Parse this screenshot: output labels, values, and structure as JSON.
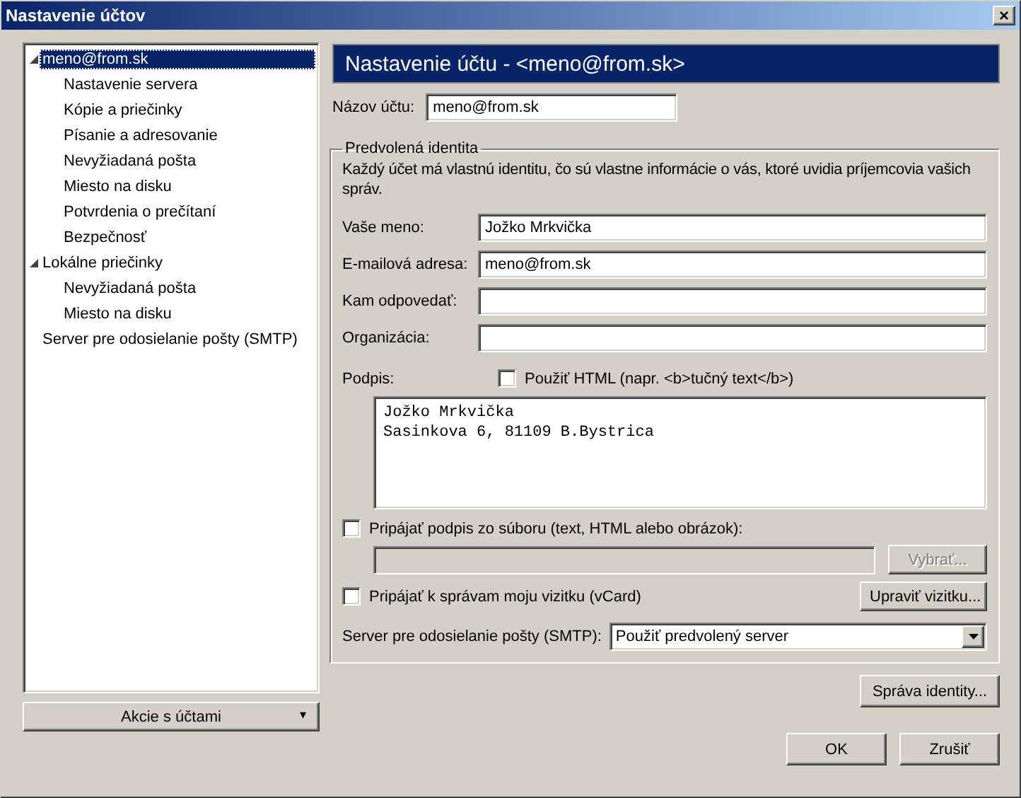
{
  "window": {
    "title": "Nastavenie účtov",
    "close": "×"
  },
  "tree": [
    {
      "label": "meno@from.sk",
      "selected": true,
      "expanded": true,
      "children": [
        {
          "label": "Nastavenie servera",
          "selected": false
        },
        {
          "label": "Kópie a priečinky",
          "selected": false
        },
        {
          "label": "Písanie a adresovanie",
          "selected": false
        },
        {
          "label": "Nevyžiadaná pošta",
          "selected": false
        },
        {
          "label": "Miesto na disku",
          "selected": false
        },
        {
          "label": "Potvrdenia o prečítaní",
          "selected": false
        },
        {
          "label": "Bezpečnosť",
          "selected": false
        }
      ]
    },
    {
      "label": "Lokálne priečinky",
      "selected": false,
      "expanded": true,
      "children": [
        {
          "label": "Nevyžiadaná pošta",
          "selected": false
        },
        {
          "label": "Miesto na disku",
          "selected": false
        }
      ]
    },
    {
      "label": "Server pre odosielanie pošty (SMTP)",
      "selected": false
    }
  ],
  "account_actions": {
    "label": "Akcie s účtami",
    "caret": "▾"
  },
  "header": "Nastavenie účtu - <meno@from.sk>",
  "account_name": {
    "label": "Názov účtu:",
    "value": "meno@from.sk"
  },
  "identity": {
    "legend": "Predvolená identita",
    "description": "Každý účet má vlastnú identitu, čo sú vlastne informácie o vás, ktoré uvidia príjemcovia vašich správ.",
    "fields": [
      {
        "label": "Vaše meno:",
        "value": "Jožko Mrkvička"
      },
      {
        "label": "E-mailová adresa:",
        "value": "meno@from.sk"
      },
      {
        "label": "Kam odpovedať:"
      },
      {
        "label": "Organizácia:"
      }
    ],
    "signature_label": "Podpis:",
    "use_html": {
      "label": "Použiť HTML (napr. <b>tučný text</b>)",
      "checked": false
    },
    "signature_lines": [
      "Jožko Mrkvička",
      "Sasinkova 6, 81109 B.Bystrica"
    ],
    "attach_file": {
      "label": "Pripájať podpis zo súboru (text, HTML alebo obrázok):",
      "checked": false
    },
    "choose_button": {
      "label": "Vybrať...",
      "disabled": true
    },
    "attach_vcard": {
      "label": "Pripájať k správam moju vizitku (vCard)",
      "checked": false
    },
    "edit_vcard_button": "Upraviť vizitku...",
    "smtp": {
      "label": "Server pre odosielanie pošty (SMTP):",
      "value": "Použiť predvolený server"
    }
  },
  "manage_identities_button": "Správa identity...",
  "buttons": [
    "OK",
    "Zrušiť"
  ]
}
